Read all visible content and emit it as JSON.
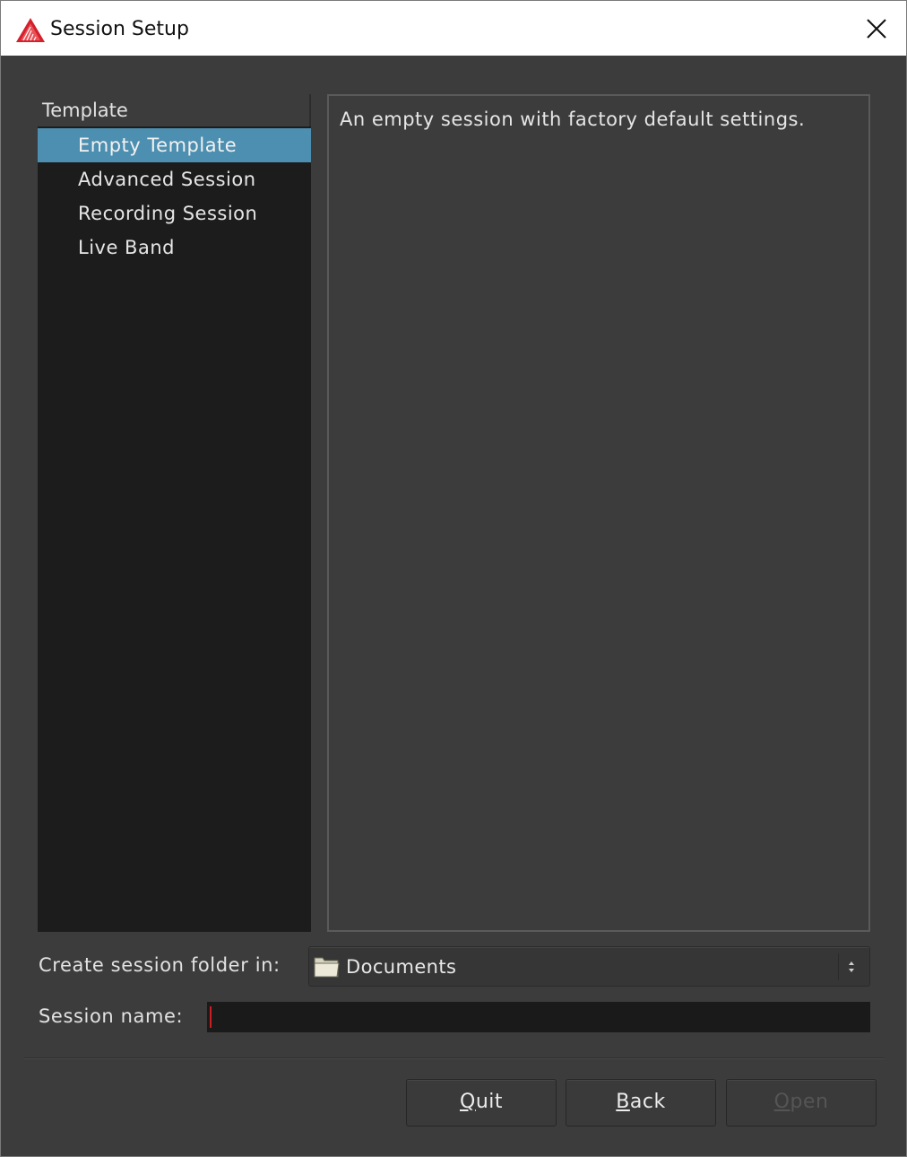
{
  "window": {
    "title": "Session Setup",
    "close_icon": "close-icon"
  },
  "templates": {
    "header": "Template",
    "items": [
      {
        "label": "Empty Template",
        "selected": true
      },
      {
        "label": "Advanced Session",
        "selected": false
      },
      {
        "label": "Recording Session",
        "selected": false
      },
      {
        "label": "Live Band",
        "selected": false
      }
    ]
  },
  "description": {
    "text": "An empty session with factory default settings."
  },
  "folder": {
    "label": "Create session folder in:",
    "value": "Documents",
    "icon": "folder-icon"
  },
  "session_name": {
    "label": "Session name:",
    "value": ""
  },
  "buttons": {
    "quit": {
      "mnemonic": "Q",
      "rest": "uit"
    },
    "back": {
      "mnemonic": "B",
      "rest": "ack"
    },
    "open": {
      "mnemonic": "O",
      "rest": "pen",
      "disabled": true
    }
  },
  "colors": {
    "selection": "#4d8fb0",
    "background": "#3c3c3c",
    "list_background": "#1c1c1c",
    "caret": "#cc1f1f",
    "logo": "#d4202a"
  }
}
